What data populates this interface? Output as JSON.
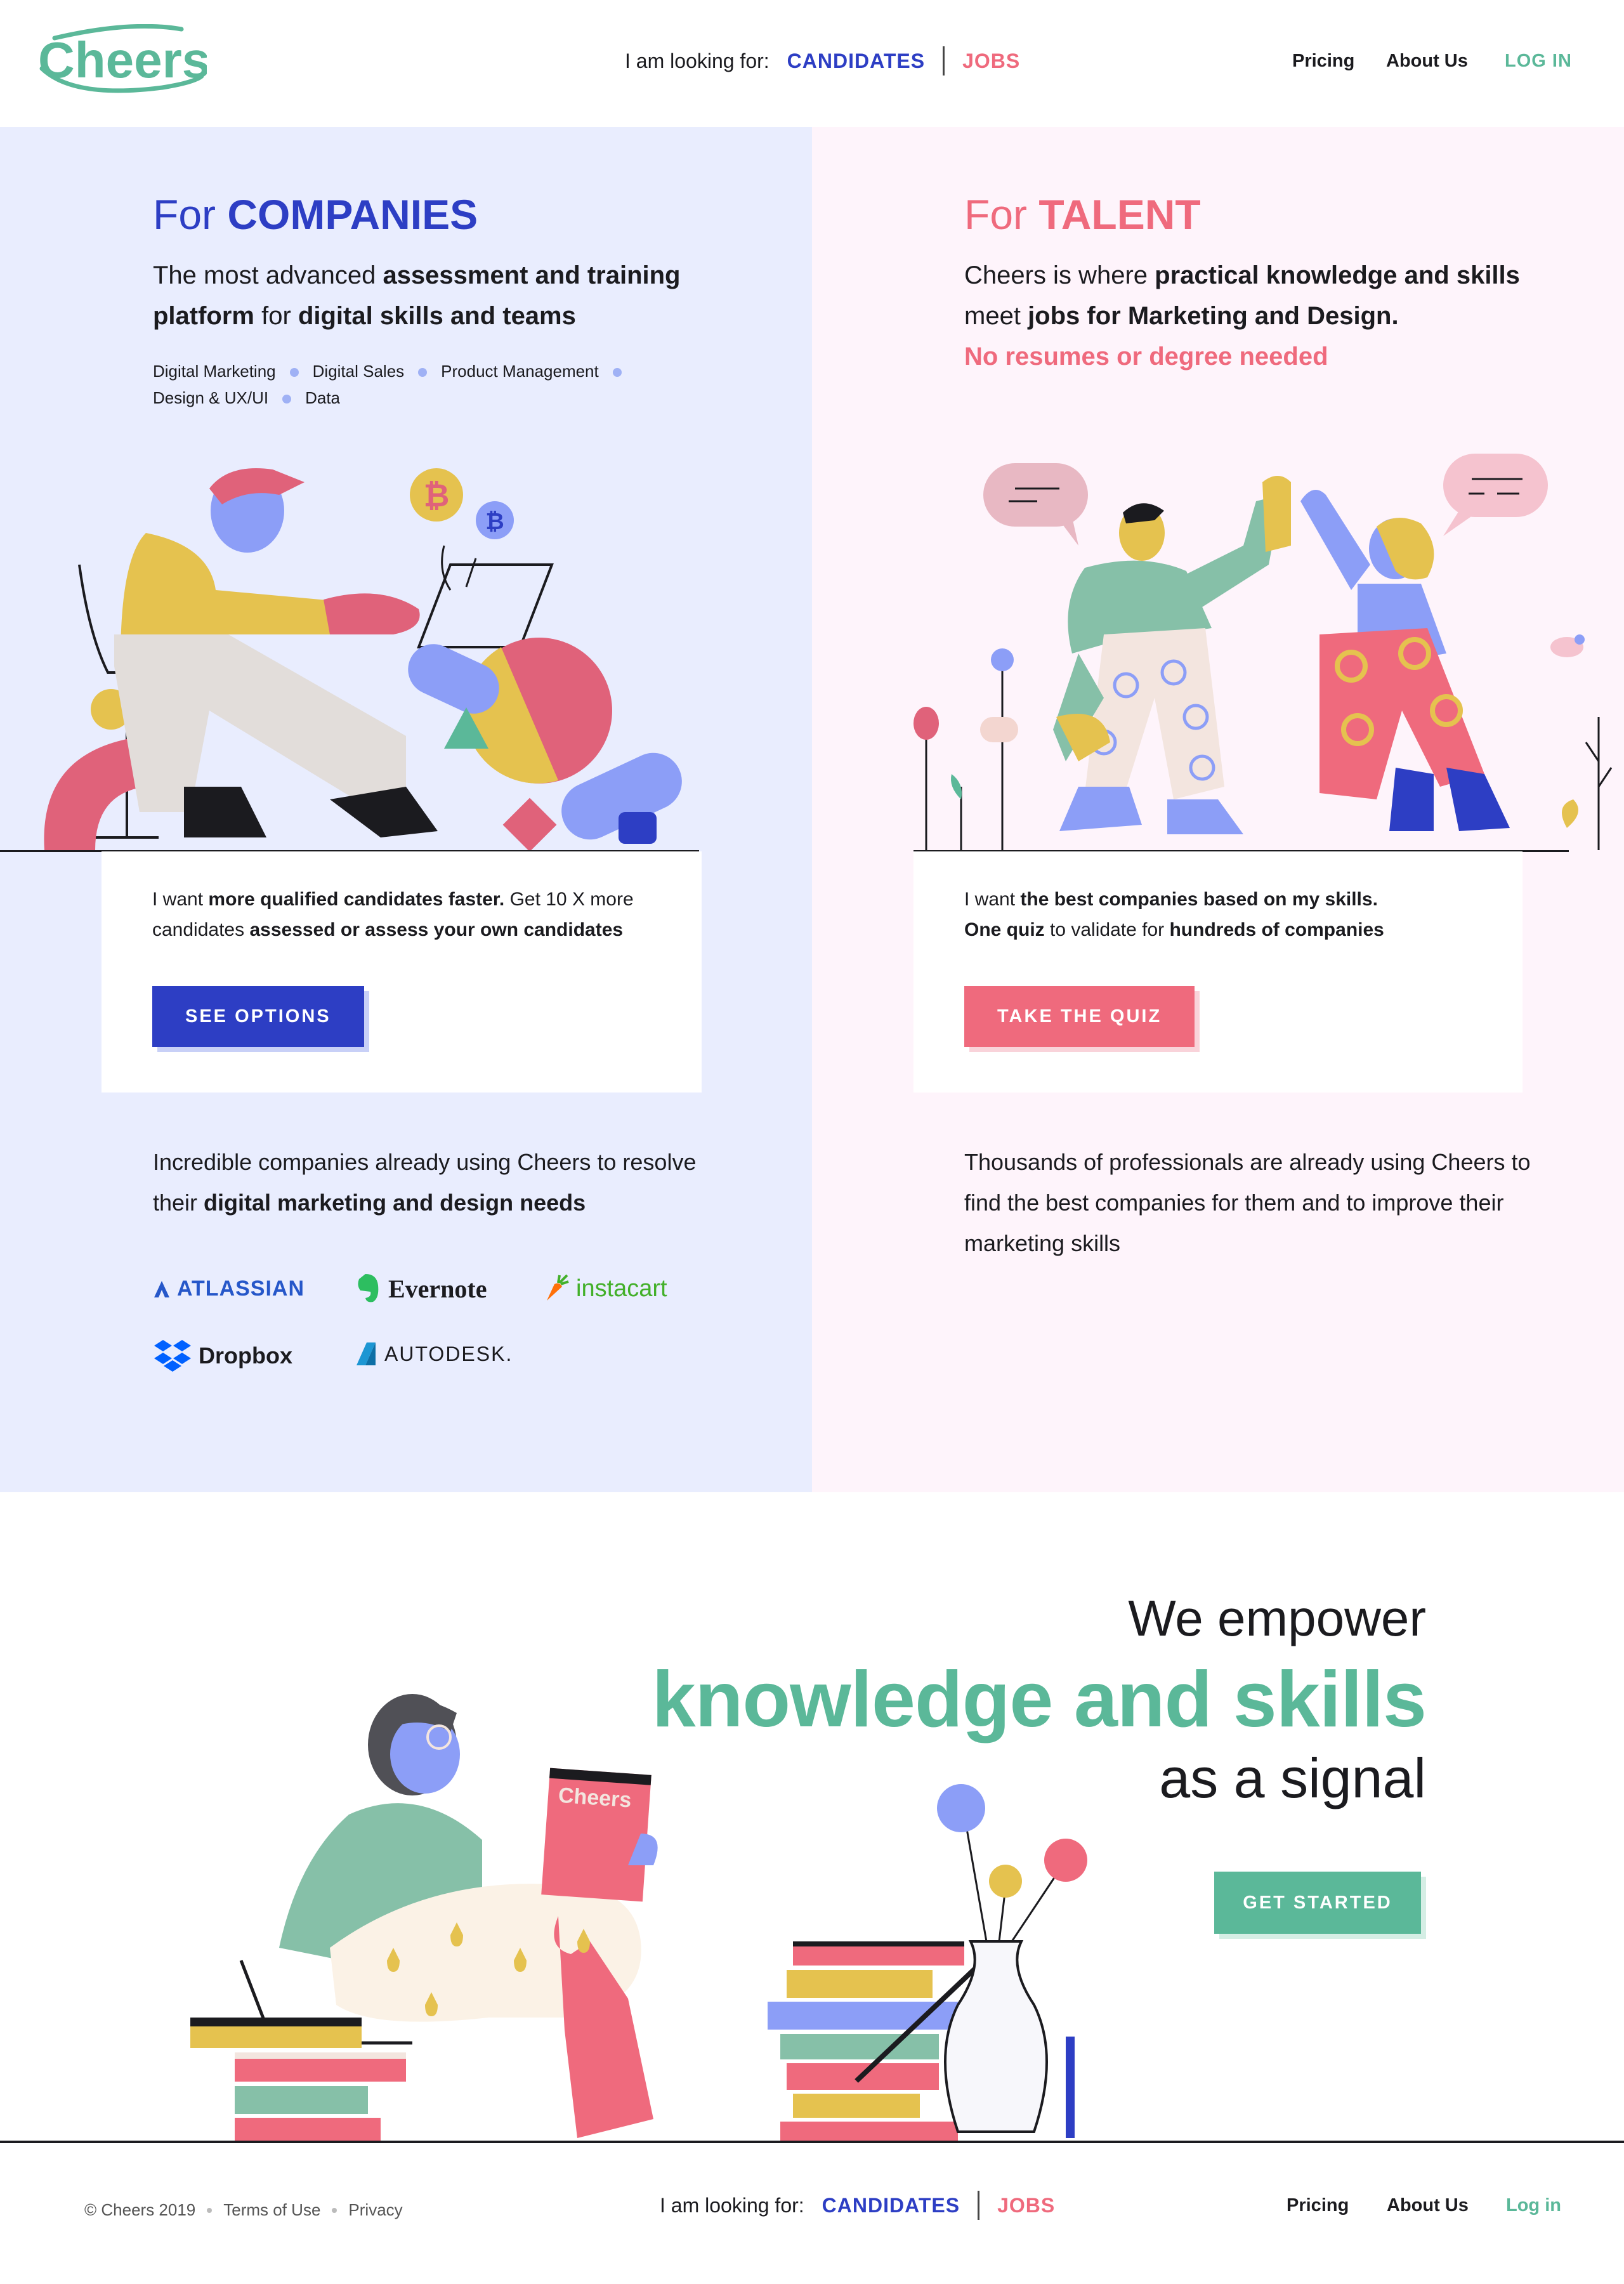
{
  "header": {
    "logo_text": "Cheers",
    "looking_for_label": "I am looking for:",
    "candidates_label": "CANDIDATES",
    "jobs_label": "JOBS",
    "nav": {
      "pricing": "Pricing",
      "about": "About Us",
      "login": "LOG IN"
    }
  },
  "companies": {
    "title_prefix": "For",
    "title_bold": "COMPANIES",
    "subtitle_1": "The most advanced",
    "subtitle_b1": "assessment and training platform",
    "subtitle_2": "for",
    "subtitle_b2": "digital skills and teams",
    "tags": [
      "Digital Marketing",
      "Digital Sales",
      "Product Management",
      "Design & UX/UI",
      "Data"
    ],
    "card_1": "I want",
    "card_b1": "more qualified candidates faster.",
    "card_2": "Get 10 X more candidates",
    "card_b2": "assessed or assess your own candidates",
    "button": "SEE OPTIONS",
    "trust_1": "Incredible companies already using Cheers to resolve their",
    "trust_b": "digital marketing and design needs",
    "brands": [
      "ATLASSIAN",
      "Evernote",
      "instacart",
      "Dropbox",
      "AUTODESK."
    ]
  },
  "talent": {
    "title_prefix": "For",
    "title_bold": "TALENT",
    "subtitle_1": "Cheers is where",
    "subtitle_b1": "practical knowledge and skills",
    "subtitle_2": "meet",
    "subtitle_b2": "jobs for Marketing and Design.",
    "subtitle_pink": "No resumes or degree needed",
    "card_1": "I want",
    "card_b1": "the best companies based on my skills.",
    "card_b2": "One quiz",
    "card_2": "to validate for",
    "card_b3": "hundreds of companies",
    "button": "TAKE THE QUIZ",
    "trust": "Thousands of  professionals are already using Cheers to find the best companies for them and to improve their marketing skills"
  },
  "empower": {
    "line1": "We empower",
    "line2": "knowledge and skills",
    "line3": "as a signal",
    "button": "GET STARTED",
    "book_label": "Cheers"
  },
  "footer": {
    "copyright": "© Cheers 2019",
    "terms": "Terms of Use",
    "privacy": "Privacy",
    "looking_for_label": "I am looking for:",
    "candidates_label": "CANDIDATES",
    "jobs_label": "JOBS",
    "nav": {
      "pricing": "Pricing",
      "about": "About Us",
      "login": "Log in"
    }
  },
  "colors": {
    "blue": "#2d3ec4",
    "pink": "#ef6a7d",
    "green": "#5bb899",
    "companies_bg": "#e9edfe",
    "talent_bg": "#fef4fb"
  }
}
